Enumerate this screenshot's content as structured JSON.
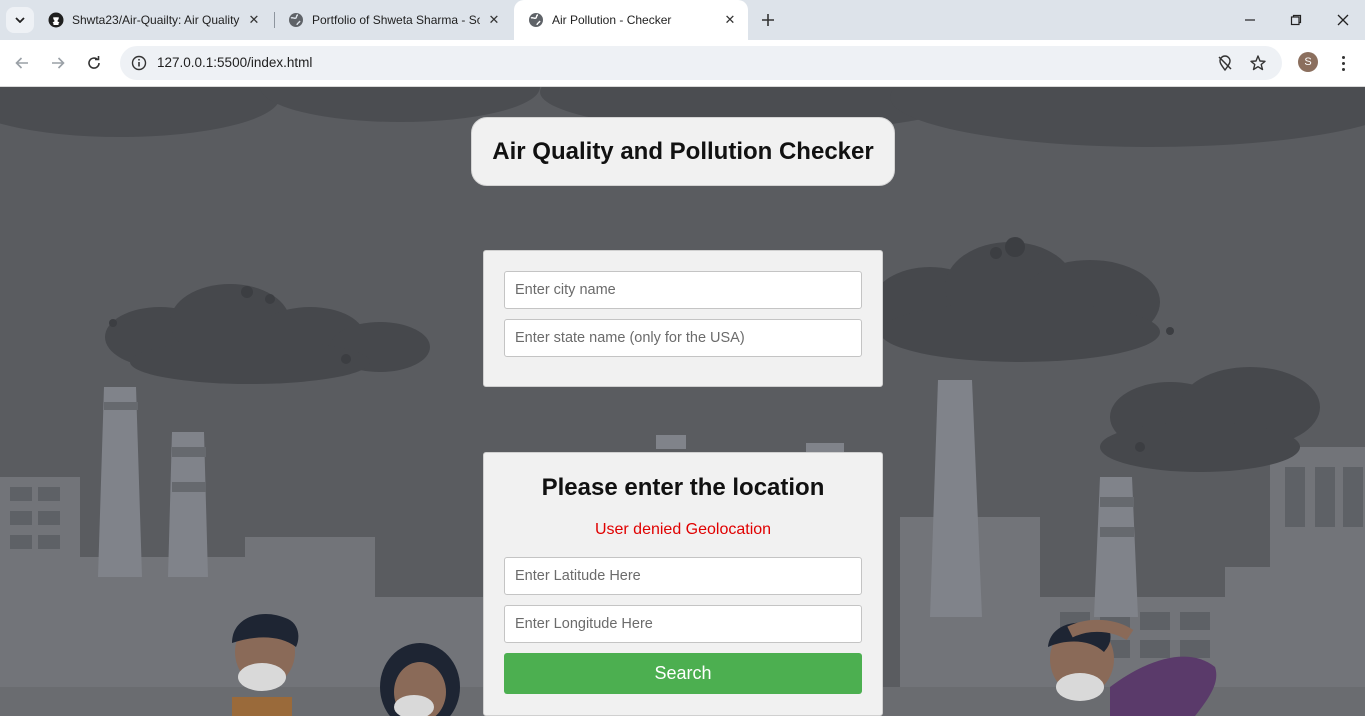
{
  "browser": {
    "tabs": [
      {
        "label": "Shwta23/Air-Quailty: Air Quality",
        "icon": "github-icon",
        "active": false
      },
      {
        "label": "Portfolio of Shweta Sharma - So",
        "icon": "globe-icon",
        "active": false
      },
      {
        "label": "Air Pollution - Checker",
        "icon": "globe-icon",
        "active": true
      }
    ],
    "url": "127.0.0.1:5500/index.html",
    "profile_initial": "S"
  },
  "page": {
    "title": "Air Quality and Pollution Checker",
    "city_form": {
      "city_placeholder": "Enter city name",
      "state_placeholder": "Enter state name (only for the USA)"
    },
    "location_form": {
      "heading": "Please enter the location",
      "error_message": "User denied Geolocation",
      "latitude_placeholder": "Enter Latitude Here",
      "longitude_placeholder": "Enter Longitude Here",
      "search_label": "Search"
    }
  },
  "colors": {
    "search_button": "#4caf50",
    "error_text": "#e00000",
    "card_background": "#f1f1f1",
    "scene_overlay": "#5d5f63"
  }
}
